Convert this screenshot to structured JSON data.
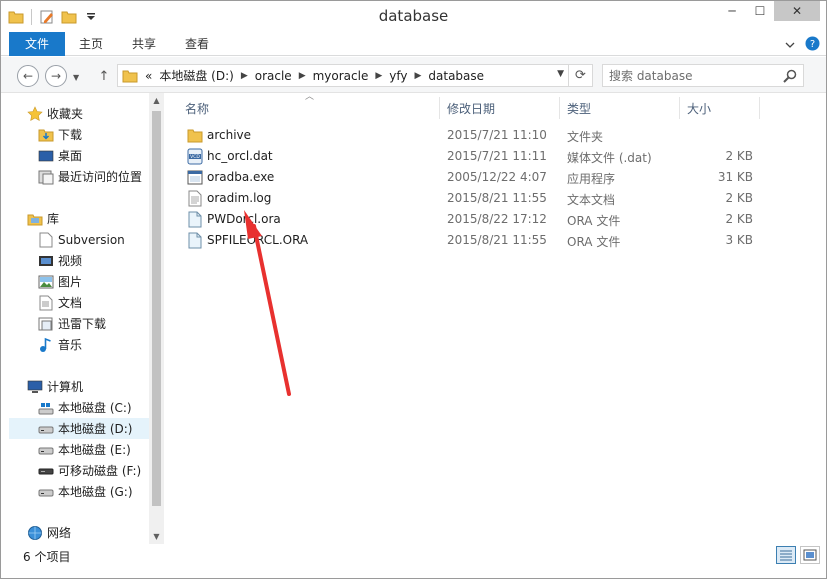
{
  "window": {
    "title": "database"
  },
  "ribbon": {
    "tabs": [
      "文件",
      "主页",
      "共享",
      "查看"
    ]
  },
  "address": {
    "crumbs": [
      "本地磁盘 (D:)",
      "oracle",
      "myoracle",
      "yfy",
      "database"
    ],
    "prefix": "«",
    "search_placeholder": "搜索 database"
  },
  "nav": {
    "favorites": {
      "label": "收藏夹",
      "items": [
        "下载",
        "桌面",
        "最近访问的位置"
      ]
    },
    "library": {
      "label": "库",
      "items": [
        "Subversion",
        "视频",
        "图片",
        "文档",
        "迅雷下载",
        "音乐"
      ]
    },
    "computer": {
      "label": "计算机",
      "items": [
        "本地磁盘 (C:)",
        "本地磁盘 (D:)",
        "本地磁盘 (E:)",
        "可移动磁盘 (F:)",
        "本地磁盘 (G:)"
      ]
    },
    "network": {
      "label": "网络"
    }
  },
  "columns": {
    "name": "名称",
    "date": "修改日期",
    "type": "类型",
    "size": "大小"
  },
  "files": [
    {
      "name": "archive",
      "date": "2015/7/21 11:10",
      "type": "文件夹",
      "size": "",
      "icon": "folder-icon"
    },
    {
      "name": "hc_orcl.dat",
      "date": "2015/7/21 11:11",
      "type": "媒体文件 (.dat)",
      "size": "2 KB",
      "icon": "vcd-file-icon"
    },
    {
      "name": "oradba.exe",
      "date": "2005/12/22 4:07",
      "type": "应用程序",
      "size": "31 KB",
      "icon": "exe-file-icon"
    },
    {
      "name": "oradim.log",
      "date": "2015/8/21 11:55",
      "type": "文本文档",
      "size": "2 KB",
      "icon": "text-file-icon"
    },
    {
      "name": "PWDorcl.ora",
      "date": "2015/8/22 17:12",
      "type": "ORA 文件",
      "size": "2 KB",
      "icon": "ora-file-icon"
    },
    {
      "name": "SPFILEORCL.ORA",
      "date": "2015/8/21 11:55",
      "type": "ORA 文件",
      "size": "3 KB",
      "icon": "ora-file-icon"
    }
  ],
  "status": {
    "count": "6 个项目"
  },
  "colors": {
    "accent": "#1979ca",
    "annotation": "#e8312f",
    "selection": "#e5f3fb"
  }
}
